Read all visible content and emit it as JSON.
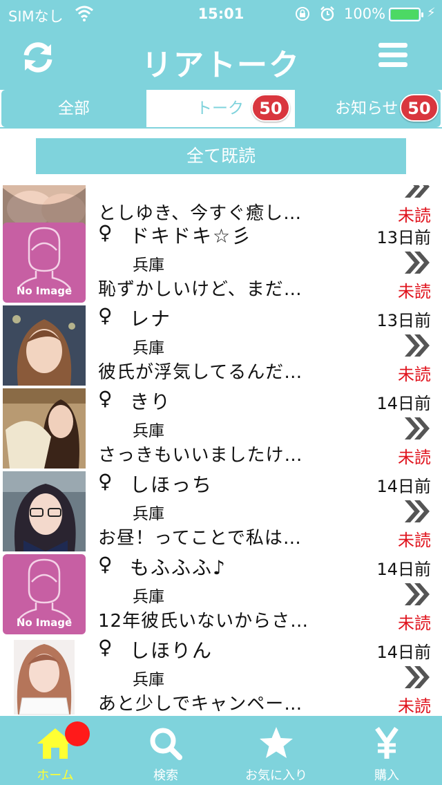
{
  "status_bar": {
    "carrier": "SIMなし",
    "time": "15:01",
    "battery": "100%"
  },
  "header": {
    "title": "リアトーク",
    "refresh_icon": "refresh-icon",
    "menu_icon": "hamburger-menu-icon"
  },
  "tabs": [
    {
      "label": "全部",
      "selected": false
    },
    {
      "label": "トーク",
      "badge": "50",
      "selected": true
    },
    {
      "label": "お知らせ",
      "badge": "50",
      "selected": false
    }
  ],
  "read_all_label": "全て既読",
  "messages": {
    "partial": {
      "message": "としゆき、今すぐ癒し…",
      "status": "未読"
    },
    "items": [
      {
        "gender": "♀",
        "name": "ドキドキ☆彡",
        "days": "13日前",
        "prefecture": "兵庫",
        "message": "恥ずかしいけど、まだ…",
        "status": "未読",
        "avatar": "no-image",
        "no_image_label": "No Image"
      },
      {
        "gender": "♀",
        "name": "レナ",
        "days": "13日前",
        "prefecture": "兵庫",
        "message": "彼氏が浮気してるんだ…",
        "status": "未読",
        "avatar": "photo"
      },
      {
        "gender": "♀",
        "name": "きり",
        "days": "14日前",
        "prefecture": "兵庫",
        "message": "さっきもいいましたけ…",
        "status": "未読",
        "avatar": "photo"
      },
      {
        "gender": "♀",
        "name": "しほっち",
        "days": "14日前",
        "prefecture": "兵庫",
        "message": "お昼！ってことで私は…",
        "status": "未読",
        "avatar": "photo"
      },
      {
        "gender": "♀",
        "name": "もふふふ♪",
        "days": "14日前",
        "prefecture": "兵庫",
        "message": "12年彼氏いないからさ…",
        "status": "未読",
        "avatar": "no-image",
        "no_image_label": "No Image"
      },
      {
        "gender": "♀",
        "name": "しほりん",
        "days": "14日前",
        "prefecture": "兵庫",
        "message": "あと少しでキャンペー…",
        "status": "未読",
        "avatar": "photo"
      }
    ]
  },
  "bottom_nav": [
    {
      "label": "ホーム",
      "icon": "home-icon",
      "active": true
    },
    {
      "label": "検索",
      "icon": "search-icon",
      "active": false
    },
    {
      "label": "お気に入り",
      "icon": "star-icon",
      "active": false
    },
    {
      "label": "購入",
      "icon": "yen-icon",
      "active": false
    }
  ],
  "colors": {
    "accent": "#7fd3dc",
    "badge": "#d9363e",
    "unread": "#e0141e",
    "no_image_bg": "#c75fa3",
    "active_nav": "#ffff33"
  }
}
